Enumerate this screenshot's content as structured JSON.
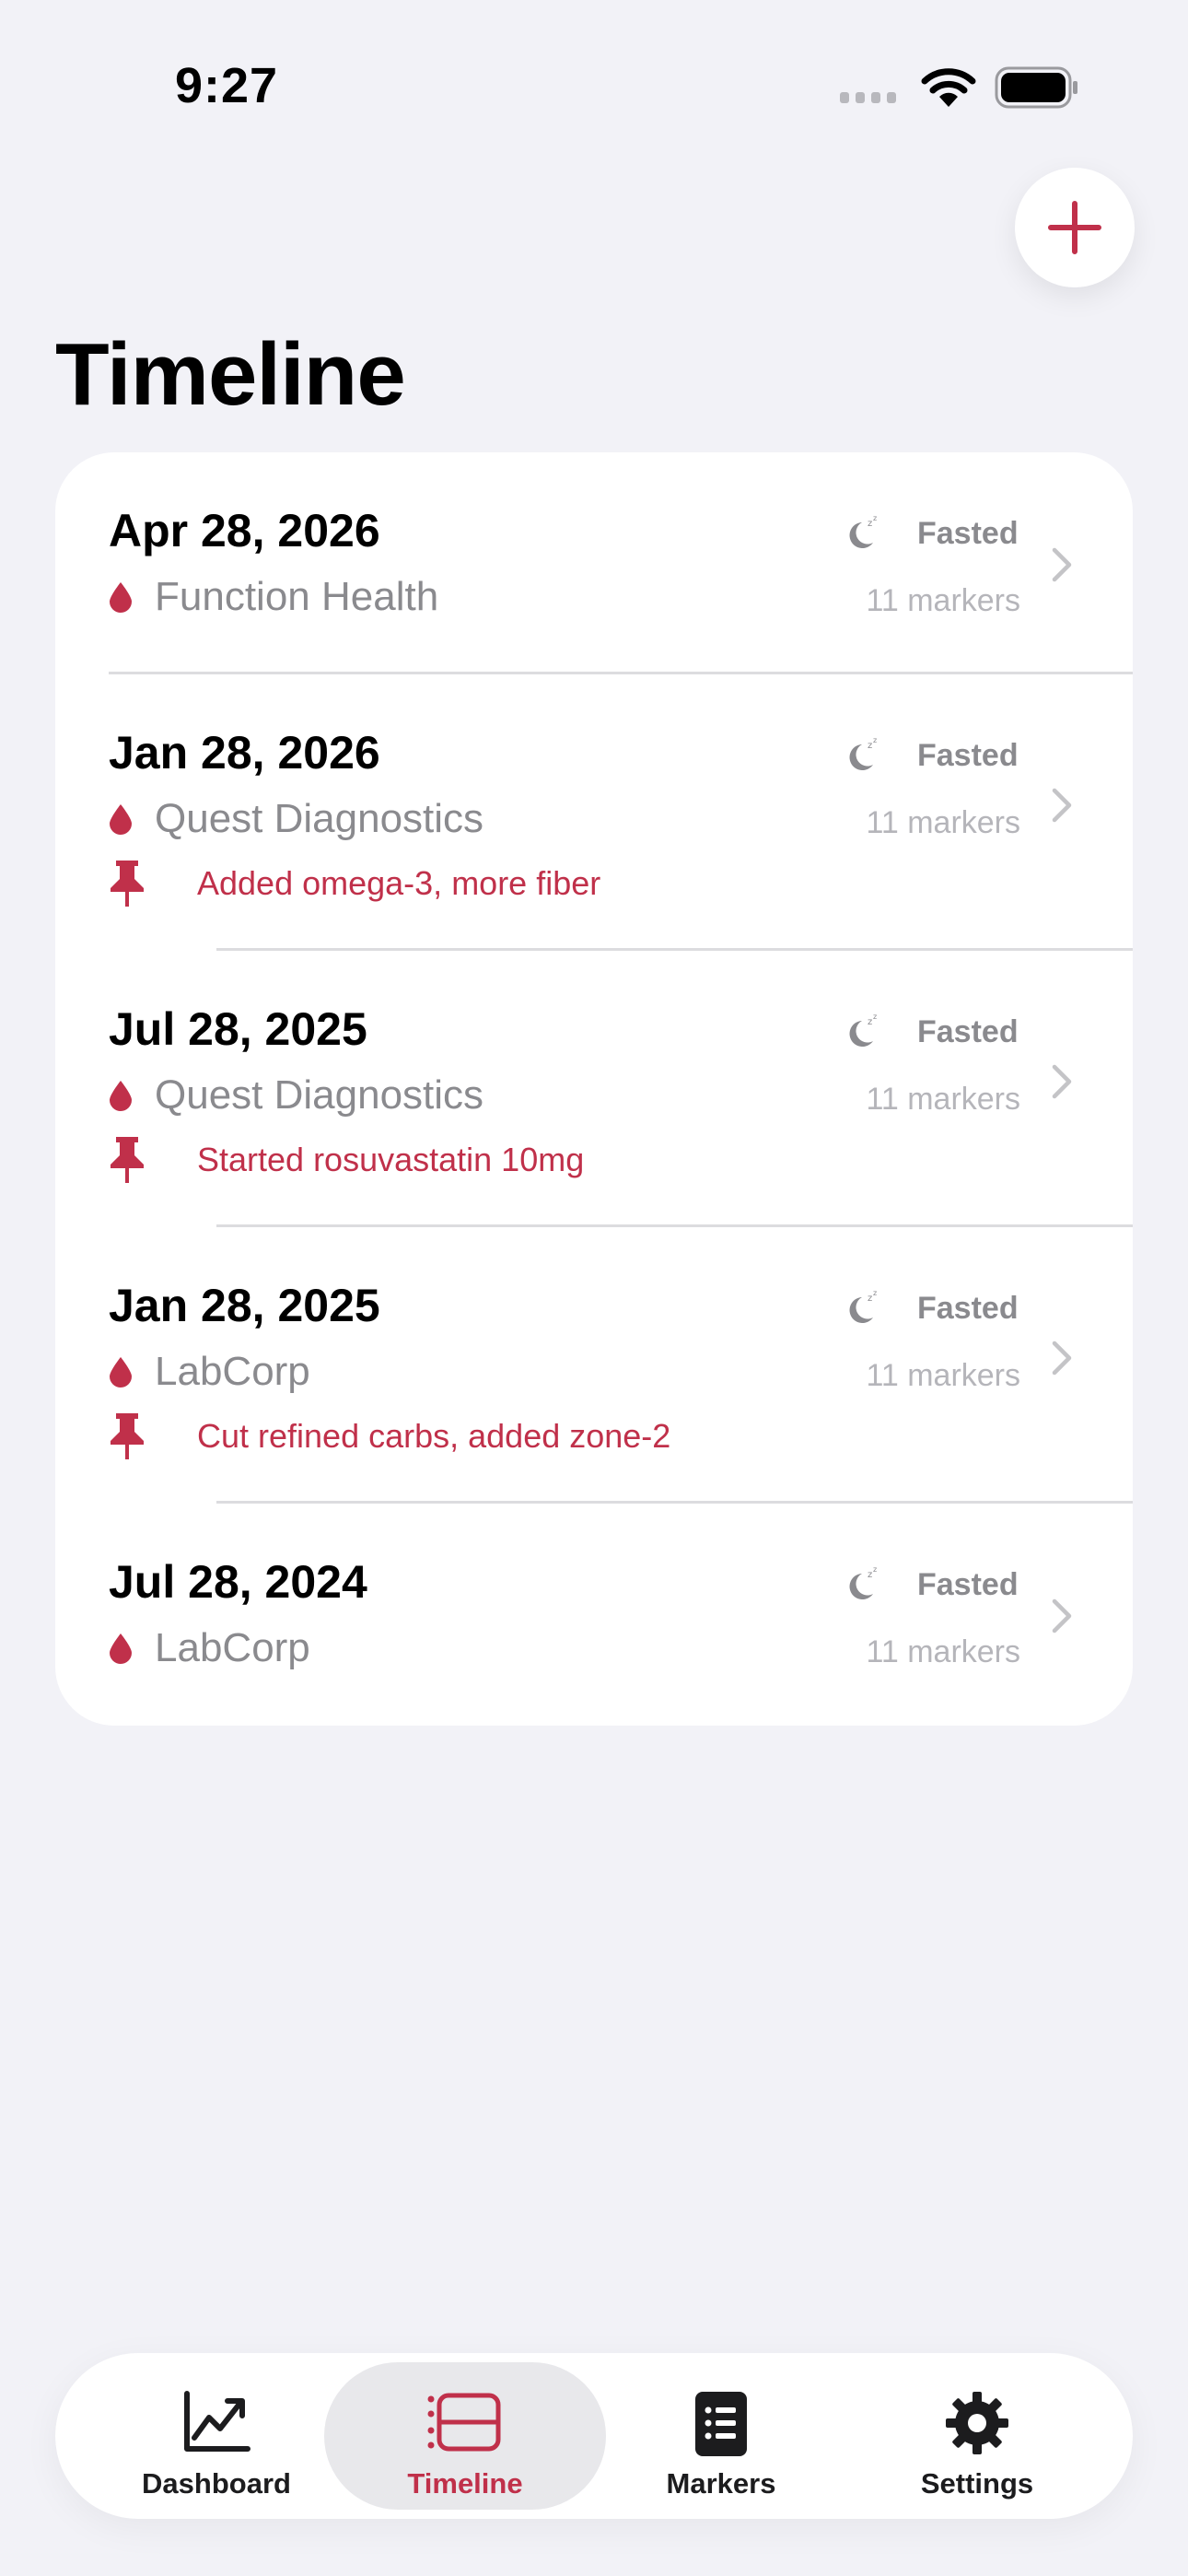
{
  "status_bar": {
    "time": "9:27"
  },
  "header": {
    "title": "Timeline",
    "add_icon": "plus-icon"
  },
  "colors": {
    "accent": "#c0304a",
    "background": "#f2f2f7",
    "secondary_text": "#8a8a8e"
  },
  "timeline": {
    "entries": [
      {
        "date": "Apr 28, 2026",
        "lab": "Function Health",
        "status": "Fasted",
        "markers": "11 markers",
        "note": ""
      },
      {
        "date": "Jan 28, 2026",
        "lab": "Quest Diagnostics",
        "status": "Fasted",
        "markers": "11 markers",
        "note": "Added omega-3, more fiber"
      },
      {
        "date": "Jul 28, 2025",
        "lab": "Quest Diagnostics",
        "status": "Fasted",
        "markers": "11 markers",
        "note": "Started rosuvastatin 10mg"
      },
      {
        "date": "Jan 28, 2025",
        "lab": "LabCorp",
        "status": "Fasted",
        "markers": "11 markers",
        "note": "Cut refined carbs, added zone-2"
      },
      {
        "date": "Jul 28, 2024",
        "lab": "LabCorp",
        "status": "Fasted",
        "markers": "11 markers",
        "note": ""
      }
    ]
  },
  "tab_bar": {
    "selected": "Timeline",
    "tabs": [
      {
        "label": "Dashboard",
        "icon": "chart-line-icon"
      },
      {
        "label": "Timeline",
        "icon": "timeline-icon"
      },
      {
        "label": "Markers",
        "icon": "list-book-icon"
      },
      {
        "label": "Settings",
        "icon": "gear-icon"
      }
    ]
  }
}
